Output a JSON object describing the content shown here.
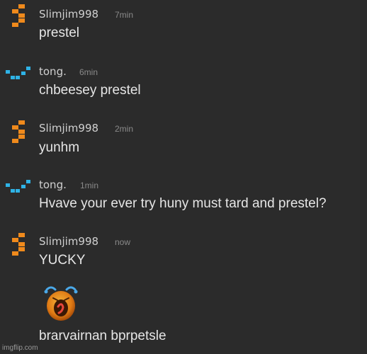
{
  "colors": {
    "background": "#2b2b2b",
    "slimjim_avatar": "#f08a1c",
    "tong_avatar": "#2fb3e6",
    "username": "#d0d0d0",
    "timestamp": "#8a8a8a",
    "message": "#e6e6e6"
  },
  "messages": [
    {
      "username": "Slimjim998",
      "time": "7min",
      "text": "prestel",
      "avatar_icon": "orange-s-pixel-avatar-icon"
    },
    {
      "username": "tong.",
      "time": "6min",
      "text": "chbeesey prestel",
      "avatar_icon": "blue-pixel-avatar-icon"
    },
    {
      "username": "Slimjim998",
      "time": "2min",
      "text": "yunhm",
      "avatar_icon": "orange-s-pixel-avatar-icon"
    },
    {
      "username": "tong.",
      "time": "1min",
      "text": "Hvave your ever try huny must tard and prestel?",
      "avatar_icon": "blue-pixel-avatar-icon"
    },
    {
      "username": "Slimjim998",
      "time": "now",
      "text": "YUCKY",
      "avatar_icon": "orange-s-pixel-avatar-icon"
    }
  ],
  "emoji_message": {
    "emoji_icon": "crying-face-emoji-icon",
    "text": "brarvairnan bprpetsle"
  },
  "watermark": "imgflip.com"
}
